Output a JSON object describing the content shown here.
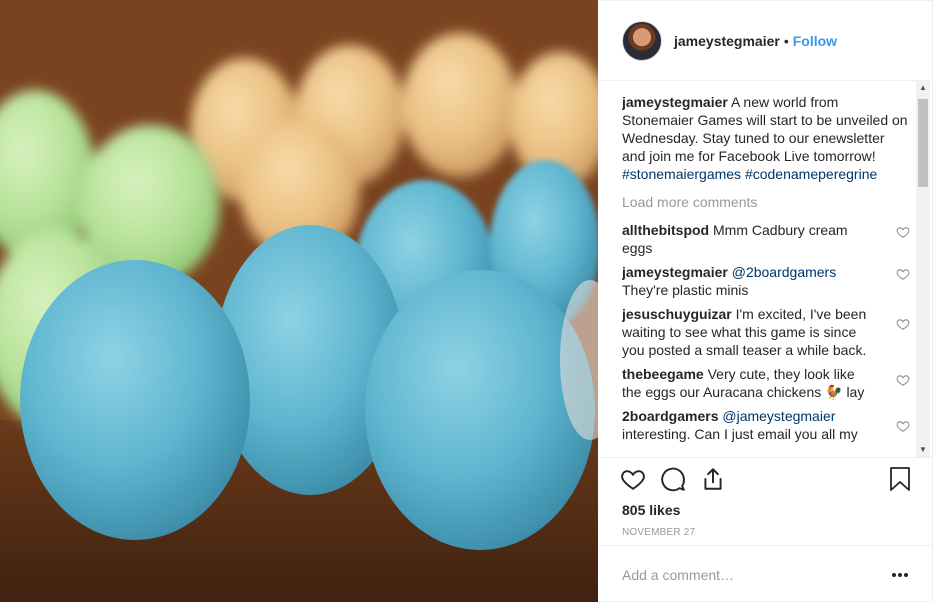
{
  "post": {
    "username": "jameystegmaier",
    "follow_label": "Follow",
    "separator": "•",
    "caption": {
      "username": "jameystegmaier",
      "text": "A new world from Stonemaier Games will start to be unveiled on Wednesday. Stay tuned to our enewsletter and join me for Facebook Live tomorrow!",
      "hashtags": [
        "#stonemaiergames",
        "#codenameperegrine"
      ]
    },
    "load_more_label": "Load more comments",
    "comments": [
      {
        "username": "allthebitspod",
        "text": "Mmm Cadbury cream eggs",
        "mention": ""
      },
      {
        "username": "jameystegmaier",
        "mention": "@2boardgamers",
        "text": "They're plastic minis"
      },
      {
        "username": "jesuschuyguizar",
        "text": "I'm excited, I've been waiting to see what this game is since you posted a small teaser a while back.",
        "mention": ""
      },
      {
        "username": "thebeegame",
        "text": "Very cute, they look like the eggs our Auracana chickens 🐓 lay",
        "mention": ""
      },
      {
        "username": "2boardgamers",
        "mention": "@jameystegmaier",
        "text": "interesting. Can I just email you all my"
      }
    ],
    "likes": "805 likes",
    "date": "NOVEMBER 27",
    "add_comment_placeholder": "Add a comment…",
    "more_options": "•••"
  },
  "colors": {
    "link_blue": "#3897f0",
    "hashtag": "#003569",
    "muted": "#999999",
    "text": "#262626",
    "divider": "#efefef"
  },
  "icons": [
    "heart-icon",
    "comment-icon",
    "share-icon",
    "bookmark-icon",
    "more-icon",
    "small-heart-icon"
  ]
}
